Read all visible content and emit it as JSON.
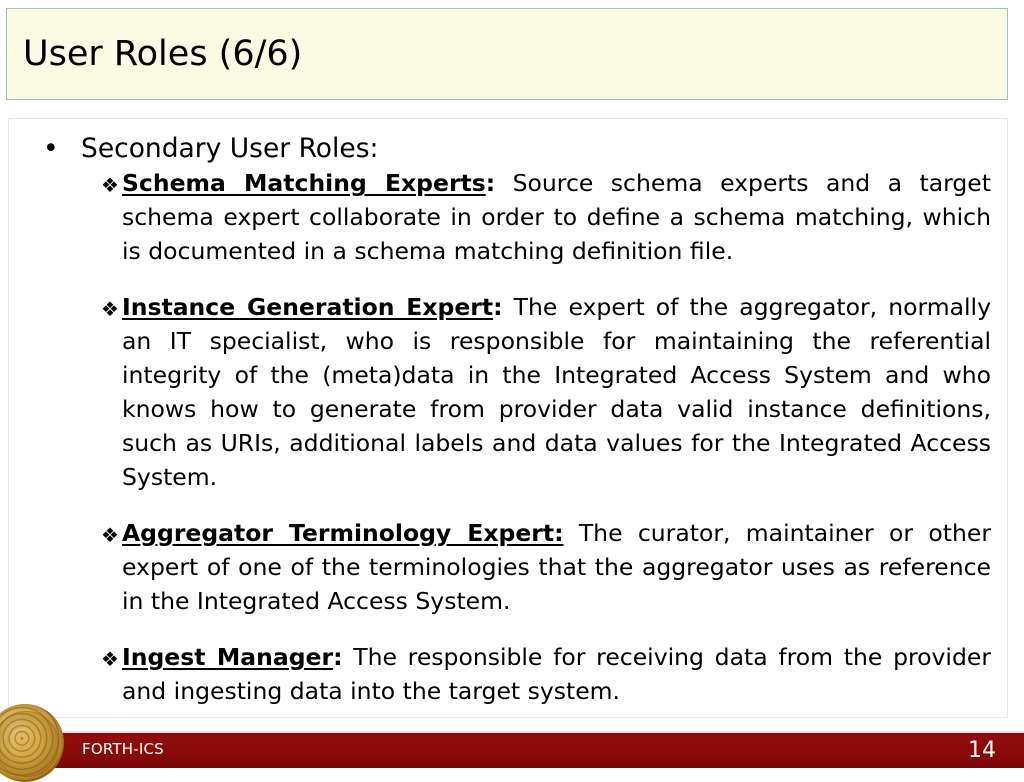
{
  "slide": {
    "title": "User Roles (6/6)",
    "heading": "Secondary User Roles:",
    "bullet_l1_glyph": "•",
    "bullet_l2_glyph": "❖",
    "items": [
      {
        "term": "Schema Matching Experts",
        "term_colon": ":",
        "body": " Source schema experts and a target schema expert collaborate in order to define a schema matching, which is documented in a schema matching definition file."
      },
      {
        "term": "Instance Generation Expert",
        "term_colon": ":",
        "body": " The expert of the aggregator, normally an IT specialist, who is responsible for maintaining the referential integrity of the (meta)data in the Integrated Access System and who knows how to generate from provider data valid instance definitions, such as URIs, additional labels and data values for the Integrated Access System."
      },
      {
        "term": "Aggregator Terminology Expert:",
        "term_colon": "",
        "body": " The curator, maintainer or other expert of one of the terminologies that the aggregator uses as reference in the Integrated Access System."
      },
      {
        "term": "Ingest Manager",
        "term_colon": ":",
        "body": " The responsible for receiving data from the provider and ingesting data into the target system."
      }
    ]
  },
  "footer": {
    "organization": "FORTH-ICS",
    "page_number": "14",
    "logo_name": "phaistos-disc-logo"
  },
  "colors": {
    "title_background": "#fbfbe3",
    "title_border": "#9bc4c0",
    "content_border": "#e8e8e8",
    "footer_background": "#8b0a0a",
    "footer_text": "#ffffff",
    "body_text": "#000000"
  }
}
